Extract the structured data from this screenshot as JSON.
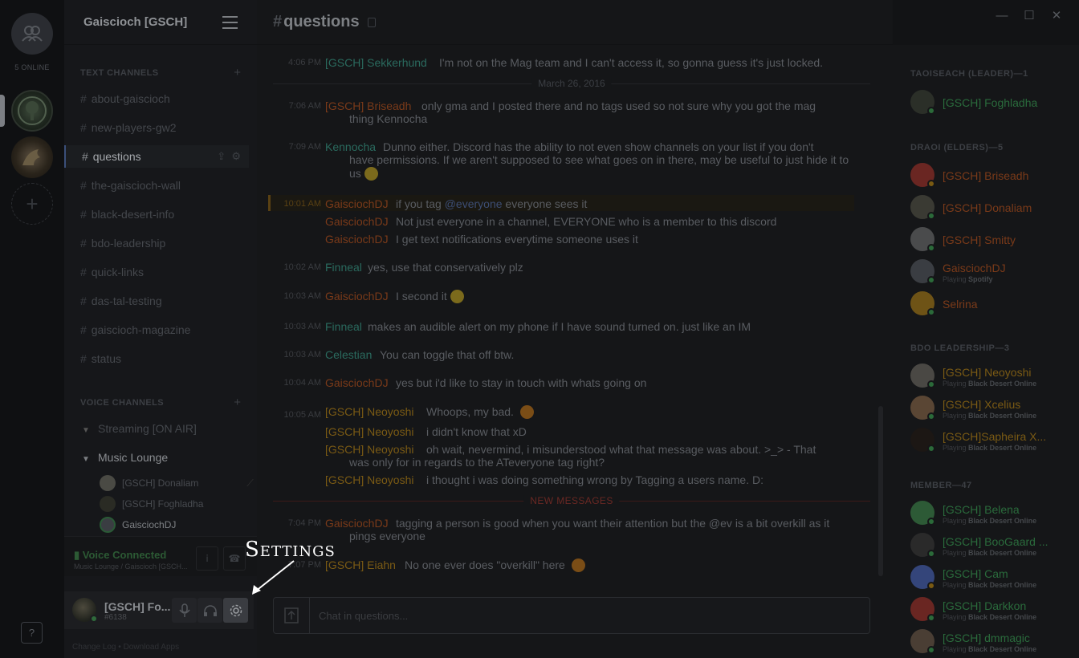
{
  "window": {
    "minimize_glyph": "—",
    "maximize_glyph": "☐",
    "close_glyph": "✕"
  },
  "servers": {
    "online_count": "5 ONLINE",
    "add_glyph": "+",
    "help_glyph": "?"
  },
  "guild": {
    "name": "Gaiscioch [GSCH]",
    "text_category": "TEXT CHANNELS",
    "voice_category": "VOICE CHANNELS",
    "add_glyph": "+",
    "text_channels": [
      "about-gaiscioch",
      "new-players-gw2",
      "questions",
      "the-gaiscioch-wall",
      "black-desert-info",
      "bdo-leadership",
      "quick-links",
      "das-tal-testing",
      "gaiscioch-magazine",
      "status"
    ],
    "voice_channels": [
      {
        "name": "Streaming [ON AIR]"
      },
      {
        "name": "Music Lounge"
      }
    ],
    "voice_users": [
      "[GSCH] Donaliam",
      "[GSCH] Foghladha",
      "GaisciochDJ"
    ]
  },
  "voice_panel": {
    "status": "Voice Connected",
    "location": "Music Lounge / Gaiscioch [GSCH..."
  },
  "user_panel": {
    "name": "[GSCH] Fo...",
    "tag": "#6138"
  },
  "footer": {
    "changelog": "Change Log",
    "separator": "•",
    "download": "Download Apps"
  },
  "chat": {
    "channel": "questions",
    "hash": "#",
    "placeholder": "Chat in questions...",
    "messages": [
      {
        "time": "4:06 PM",
        "author": "[GSCH] Sekkerhund",
        "text": "I'm not on the Mag team and I can't access it, so gonna guess it's just locked."
      },
      {
        "time": "7:06 AM",
        "author": "[GSCH] Briseadh",
        "text": "only gma and I posted there and no tags used so not sure why you got the mag",
        "text2": "thing Kennocha"
      },
      {
        "time": "7:09 AM",
        "author": "Kennocha",
        "text": "Dunno either. Discord has the ability to not even show channels on your list if you don't",
        "text2": "have permissions. If we aren't supposed to see what goes on in there, may be useful to just hide it to",
        "text3": "us"
      },
      {
        "time": "10:01 AM",
        "author": "GaisciochDJ",
        "text_before": "if you tag",
        "mention": "@everyone",
        "text_after": "everyone sees it"
      },
      {
        "author": "GaisciochDJ",
        "text": "Not just everyone in a channel, EVERYONE who is a member to this discord"
      },
      {
        "author": "GaisciochDJ",
        "text": "I get text notifications everytime someone uses it"
      },
      {
        "time": "10:02 AM",
        "author": "Finneal",
        "text": "yes, use that conservatively plz"
      },
      {
        "time": "10:03 AM",
        "author": "GaisciochDJ",
        "text": "I second it"
      },
      {
        "time": "10:03 AM",
        "author": "Finneal",
        "text": "makes an audible alert on my phone if I have sound turned on.  just like an IM"
      },
      {
        "time": "10:03 AM",
        "author": "Celestian",
        "text": "You can toggle that off btw."
      },
      {
        "time": "10:04 AM",
        "author": "GaisciochDJ",
        "text": "yes but i'd like to stay in touch with whats going on"
      },
      {
        "time": "10:05 AM",
        "author": "[GSCH] Neoyoshi",
        "text": "Whoops, my bad."
      },
      {
        "author": "[GSCH] Neoyoshi",
        "text": "i didn't know that xD"
      },
      {
        "author": "[GSCH] Neoyoshi",
        "text": "oh wait, nevermind, i misunderstood what that message was about. >_>  - That",
        "text2": "was only for in regards to the ATeveryone tag right?"
      },
      {
        "author": "[GSCH] Neoyoshi",
        "text": "i thought i was doing something wrong by Tagging a users name.  D:"
      },
      {
        "time": "7:04 PM",
        "author": "GaisciochDJ",
        "text": "tagging a person is good when you want their attention but the @ev is a bit overkill as it",
        "text2": "pings everyone"
      },
      {
        "time": "7:07 PM",
        "author": "[GSCH] Eiahn",
        "text": "No one ever does \"overkill\" here"
      }
    ],
    "date_divider": "March 26, 2016",
    "new_messages_divider": "NEW MESSAGES"
  },
  "members": {
    "groups": [
      {
        "title": "TAOISEACH (LEADER)—1"
      },
      {
        "title": "DRAOI (ELDERS)—5"
      },
      {
        "title": "BDO LEADERSHIP—3"
      },
      {
        "title": "MEMBER—47"
      }
    ],
    "list": [
      {
        "name": "[GSCH] Foghladha"
      },
      {
        "name": "[GSCH] Briseadh"
      },
      {
        "name": "[GSCH] Donaliam"
      },
      {
        "name": "[GSCH] Smitty"
      },
      {
        "name": "GaisciochDJ",
        "playing": "Playing",
        "game": "Spotify"
      },
      {
        "name": "Selrina"
      },
      {
        "name": "[GSCH] Neoyoshi",
        "playing": "Playing",
        "game": "Black Desert Online"
      },
      {
        "name": "[GSCH] Xcelius",
        "playing": "Playing",
        "game": "Black Desert Online"
      },
      {
        "name": "[GSCH]Sapheira X...",
        "playing": "Playing",
        "game": "Black Desert Online"
      },
      {
        "name": "[GSCH] Belena",
        "playing": "Playing",
        "game": "Black Desert Online"
      },
      {
        "name": "[GSCH] BooGaard ...",
        "playing": "Playing",
        "game": "Black Desert Online"
      },
      {
        "name": "[GSCH] Cam",
        "playing": "Playing",
        "game": "Black Desert Online"
      },
      {
        "name": "[GSCH] Darkkon",
        "playing": "Playing",
        "game": "Black Desert Online"
      },
      {
        "name": "[GSCH] dmmagic",
        "playing": "Playing",
        "game": "Black Desert Online"
      }
    ]
  },
  "annotation": {
    "label": "Settings"
  },
  "colors": {
    "leader_green": "#2a6b3c",
    "elder_orange": "#7a3a19",
    "bdo_gold": "#7a5a14",
    "member_green": "#2a6b3c",
    "celestian_teal": "#2a6a5e"
  }
}
